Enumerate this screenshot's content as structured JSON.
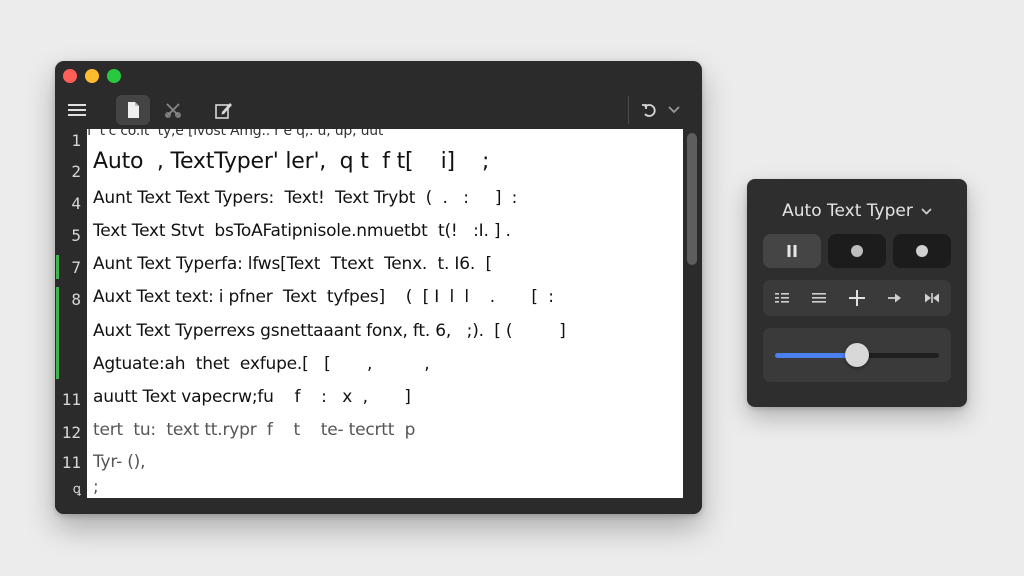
{
  "editor": {
    "line_numbers": [
      "1",
      "2",
      "4",
      "5",
      "7",
      "8",
      "11",
      "12",
      "11",
      "ꝗ"
    ],
    "top_partial_line": "f' t'c co.it  ty,e [ivost Amg.. r'e q,. u, up, uut",
    "lines": [
      "Auto  , TextTyper' ler',  q t  f t[    i]    ;",
      "Aunt Text Text Typers:  Text!  Text Trybt  (  .   :     ]  :",
      "Text Text Stvt  bsToAFatipnisole.nmuetbt  t(!   :I. ] .",
      "Aunt Text Typerfa: lfws[Text  Ttext  Tenx.  t. I6.  [",
      "Auxt Text text: i pfner  Text  tyfpes]    (  [ I  l  l    .       [  :",
      "Auxt Text Typerrexs gsnettaaant fonx, ft. 6,   ;).  [ (         ]",
      "Agtuate:ah  thet  exfupe.[   [       ,          ,",
      "auutt Text vapecrw;fu    f    :   x  ,       ]",
      "tert  tu:  text tt.rypr  f    t    te- tecrtt  p",
      "Tyr- (),",
      ";"
    ]
  },
  "panel": {
    "title": "Auto Text Typer",
    "slider_value": 0.5
  },
  "icons": {
    "menu": "hamburger-menu-icon",
    "new_file": "new-file-icon",
    "cut": "scissors-icon",
    "edit": "edit-pencil-icon",
    "undo": "undo-icon",
    "dropdown": "chevron-down-icon"
  },
  "colors": {
    "accent": "#4a80f0",
    "change_marker": "#3fb34f",
    "close": "#fe5f57",
    "minimize": "#febc2e",
    "zoom": "#28c840"
  }
}
